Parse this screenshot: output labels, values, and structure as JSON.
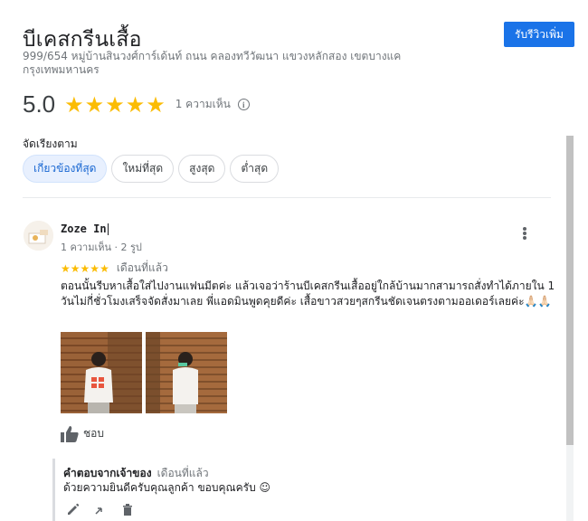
{
  "place": {
    "title": "บีเคสกรีนเสื้อ",
    "address": "999/654 หมู่บ้านสินวงศ์การ์เด้นท์ ถนน คลองทวีวัฒนา แขวงหลักสอง เขตบางแค กรุงเทพมหานคร",
    "write_review_label": "รับรีวิวเพิ่ม"
  },
  "summary": {
    "rating": "5.0",
    "stars": 5,
    "review_count": "1 ความเห็น"
  },
  "sort": {
    "label": "จัดเรียงตาม",
    "options": [
      "เกี่ยวข้องที่สุด",
      "ใหม่ที่สุด",
      "สูงสุด",
      "ต่ำสุด"
    ],
    "selected": "เกี่ยวข้องที่สุด"
  },
  "review": {
    "author": "Zoze In",
    "meta": "1 ความเห็น · 2 รูป",
    "stars": 5,
    "date": "เดือนที่แล้ว",
    "text": "ตอนนั้นรีบหาเสื้อใส่ไปงานแฟนมีตค่ะ แล้วเจอว่าร้านบีเคสกรีนเสื้ออยู่ใกล้บ้านมากสามารถสั่งทำได้ภายใน 1 วันไม่กี่ชั่วโมงเสร็จจัดสั่งมาเลย พี่แอดมินพูดคุยดีค่ะ เสื้อขาวสวยๆสกรีนชัดเจนตรงตามออเดอร์เลยค่ะ🙏🏻🙏🏻",
    "photos": [
      {
        "alt": "person-in-white-shirt-back-view",
        "accent": "#e8563e"
      },
      {
        "alt": "person-in-white-shirt-side-view",
        "accent": "#58c8a0"
      }
    ],
    "like_label": "ชอบ",
    "reply": {
      "owner_label": "คำตอบจากเจ้าของ",
      "date": "เดือนที่แล้ว",
      "text": "ด้วยความยินดีครับคุณลูกค้า ขอบคุณครับ ☺"
    }
  },
  "colors": {
    "accent": "#1a73e8",
    "star": "#fbbc04",
    "wood": "#a0663a"
  }
}
